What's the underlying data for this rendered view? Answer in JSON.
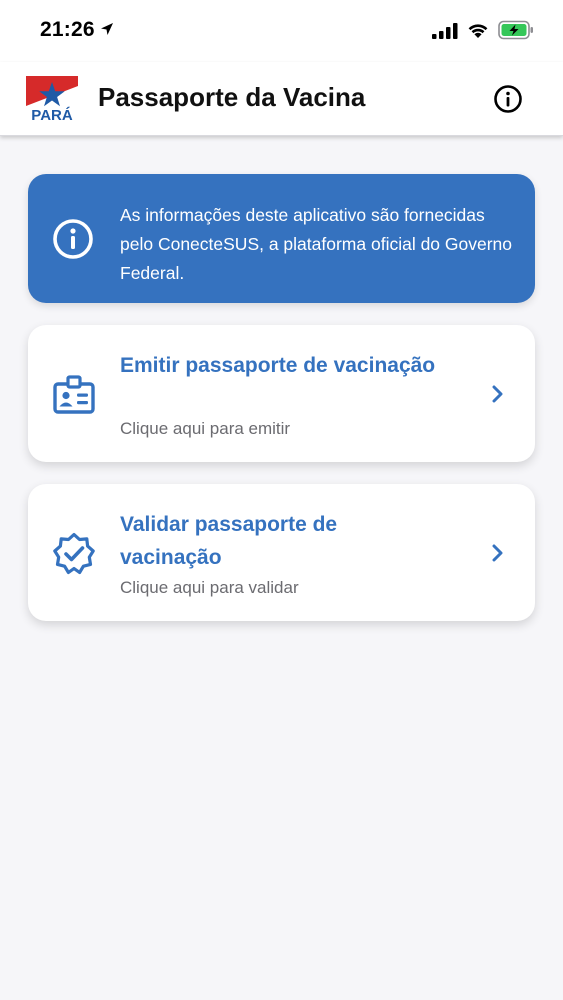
{
  "status_bar": {
    "time": "21:26"
  },
  "header": {
    "title": "Passaporte da Vacina",
    "logo_text": "PARÁ",
    "icons": [
      "para-logo-icon",
      "info-icon"
    ]
  },
  "banner": {
    "text": "As informações deste aplicativo são fornecidas pelo ConecteSUS, a plataforma oficial do Governo Federal.",
    "icon": "info-icon"
  },
  "cards": [
    {
      "title": "Emitir passaporte de vacinação",
      "subtitle": "Clique aqui para emitir",
      "icon": "id-badge-icon"
    },
    {
      "title": "Validar passaporte de vacinação",
      "subtitle": "Clique aqui para validar",
      "icon": "verified-badge-icon"
    }
  ],
  "colors": {
    "accent": "#3572bf",
    "background": "#f6f6f9",
    "card": "#ffffff",
    "subtitle": "#6b6b70",
    "logo_red": "#d62a2a",
    "logo_blue": "#1f5aa6",
    "battery_green": "#35c759"
  }
}
